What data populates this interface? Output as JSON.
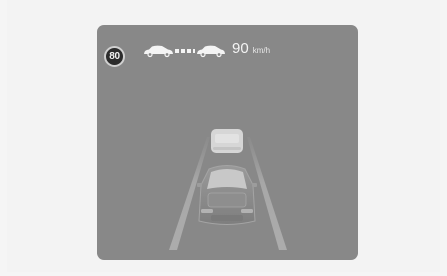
{
  "display": {
    "speed_limit": "80",
    "set_speed": "90",
    "set_speed_unit": "km/h"
  },
  "icons": {
    "speed_limit_sign": "speed-limit-sign-icon",
    "adaptive_cruise": "adaptive-cruise-distance-icon",
    "vehicle_ahead": "vehicle-ahead-icon",
    "own_vehicle": "own-vehicle-icon"
  },
  "colors": {
    "screen_background": "#888888",
    "sign_background": "#2c2c2c",
    "text": "#f4f4f4"
  }
}
